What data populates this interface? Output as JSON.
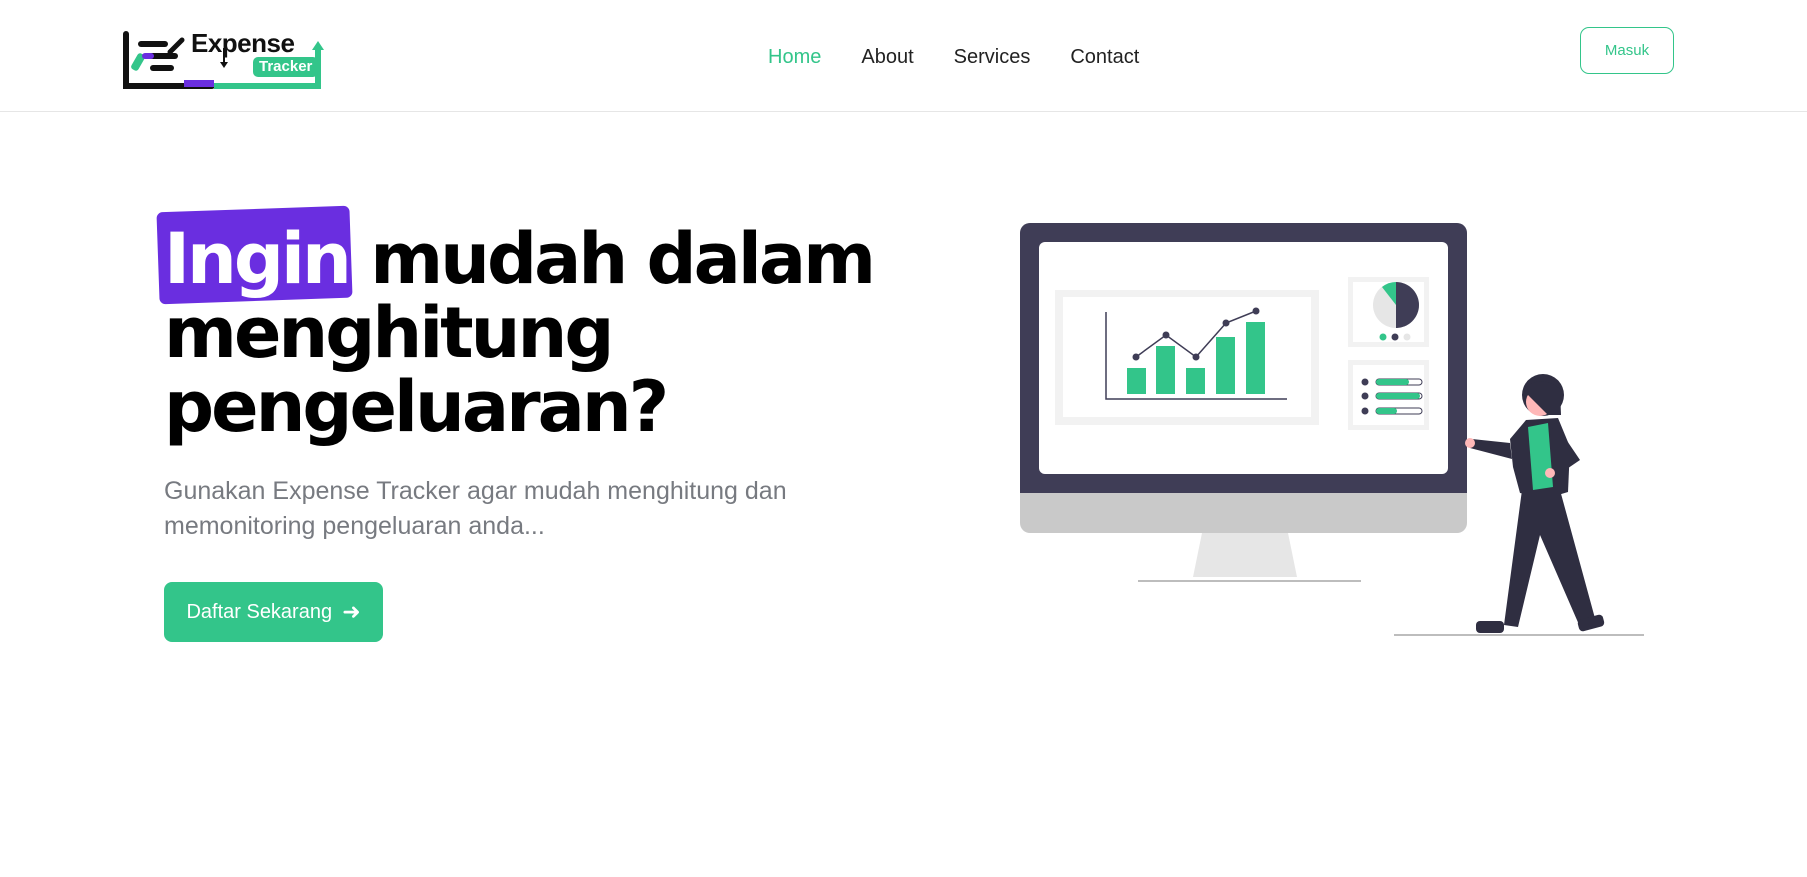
{
  "brand": {
    "name": "Expense",
    "badge": "Tracker"
  },
  "nav": {
    "items": [
      {
        "label": "Home",
        "active": true
      },
      {
        "label": "About",
        "active": false
      },
      {
        "label": "Services",
        "active": false
      },
      {
        "label": "Contact",
        "active": false
      }
    ],
    "login_label": "Masuk"
  },
  "hero": {
    "title_highlight": "Ingin",
    "title_rest": " mudah dalam menghitung pengeluaran?",
    "subtitle": "Gunakan Expense Tracker agar mudah menghitung dan memonitoring pengeluaran anda...",
    "cta_label": "Daftar Sekarang",
    "cta_icon": "arrow-right-icon"
  },
  "colors": {
    "accent": "#33c58a",
    "highlight": "#6a2ee0",
    "dark": "#3f3d56"
  }
}
